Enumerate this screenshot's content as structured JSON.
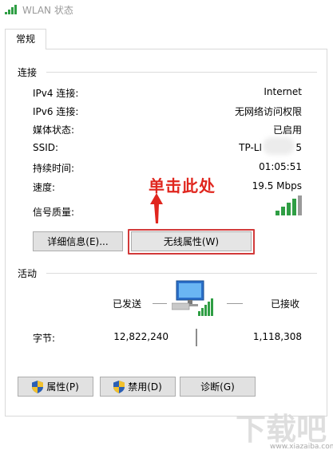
{
  "window": {
    "title": "WLAN 状态",
    "icon": "wifi-signal-icon"
  },
  "tab": {
    "label": "常规"
  },
  "connection": {
    "heading": "连接",
    "rows": [
      {
        "label": "IPv4 连接:",
        "value": "Internet"
      },
      {
        "label": "IPv6 连接:",
        "value": "无网络访问权限"
      },
      {
        "label": "媒体状态:",
        "value": "已启用"
      },
      {
        "label": "SSID:",
        "value": "TP-LI",
        "value_suffix": "5"
      },
      {
        "label": "持续时间:",
        "value": "01:05:51"
      },
      {
        "label": "速度:",
        "value": "19.5 Mbps"
      }
    ],
    "signal_label": "信号质量:",
    "signal_bars": 4
  },
  "buttons": {
    "details": "详细信息(E)...",
    "wireless_props": "无线属性(W)",
    "properties": "属性(P)",
    "disable": "禁用(D)",
    "diagnose": "诊断(G)"
  },
  "annotation": {
    "text": "单击此处",
    "color": "#e0261e"
  },
  "activity": {
    "heading": "活动",
    "sent_label": "已发送",
    "received_label": "已接收",
    "bytes_label": "字节:",
    "bytes_sent": "12,822,240",
    "bytes_received": "1,118,308"
  },
  "watermark": {
    "text": "下载吧",
    "sub": "www.xiazaiba.com"
  },
  "colors": {
    "highlight": "#d23a3a",
    "accent_green": "#3aa13a"
  }
}
